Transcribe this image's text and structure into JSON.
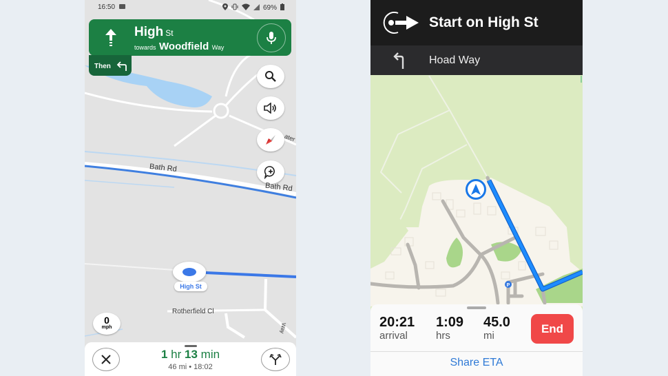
{
  "google_maps": {
    "status_bar": {
      "time": "16:50",
      "battery": "69%"
    },
    "maneuver": {
      "street": "High",
      "street_suffix": "St",
      "towards_label": "towards",
      "towards_street": "Woodfield",
      "towards_suffix": "Way",
      "icon": "straight-arrow-icon"
    },
    "then": {
      "label": "Then",
      "icon": "turn-left-icon"
    },
    "fabs": [
      "search-icon",
      "volume-icon",
      "compass-icon",
      "add-report-icon"
    ],
    "map_labels": {
      "bath_rd_1": "Bath Rd",
      "bath_rd_2": "Bath Rd",
      "partial_street": "ater",
      "rotherfield": "Rotherfield Cl",
      "side_way": "Way"
    },
    "position_label": "High St",
    "speed": {
      "value": "0",
      "unit": "mph"
    },
    "trip": {
      "hours": "1",
      "hours_unit": "hr",
      "minutes": "13",
      "minutes_unit": "min",
      "distance": "46 mi",
      "separator": "•",
      "arrival": "18:02"
    },
    "colors": {
      "nav_green": "#1c8044",
      "route_blue": "#3b78e7"
    }
  },
  "apple_maps": {
    "maneuver": {
      "title": "Start on High St",
      "icon": "start-route-icon"
    },
    "next": {
      "label": "Hoad Way",
      "icon": "turn-left-icon"
    },
    "stats": [
      {
        "value": "20:21",
        "label": "arrival"
      },
      {
        "value": "1:09",
        "label": "hrs"
      },
      {
        "value": "45.0",
        "label": "mi"
      }
    ],
    "end_label": "End",
    "share_label": "Share ETA",
    "colors": {
      "end_red": "#f04848",
      "route_blue": "#1877e8",
      "link_blue": "#2f7ad6"
    }
  }
}
